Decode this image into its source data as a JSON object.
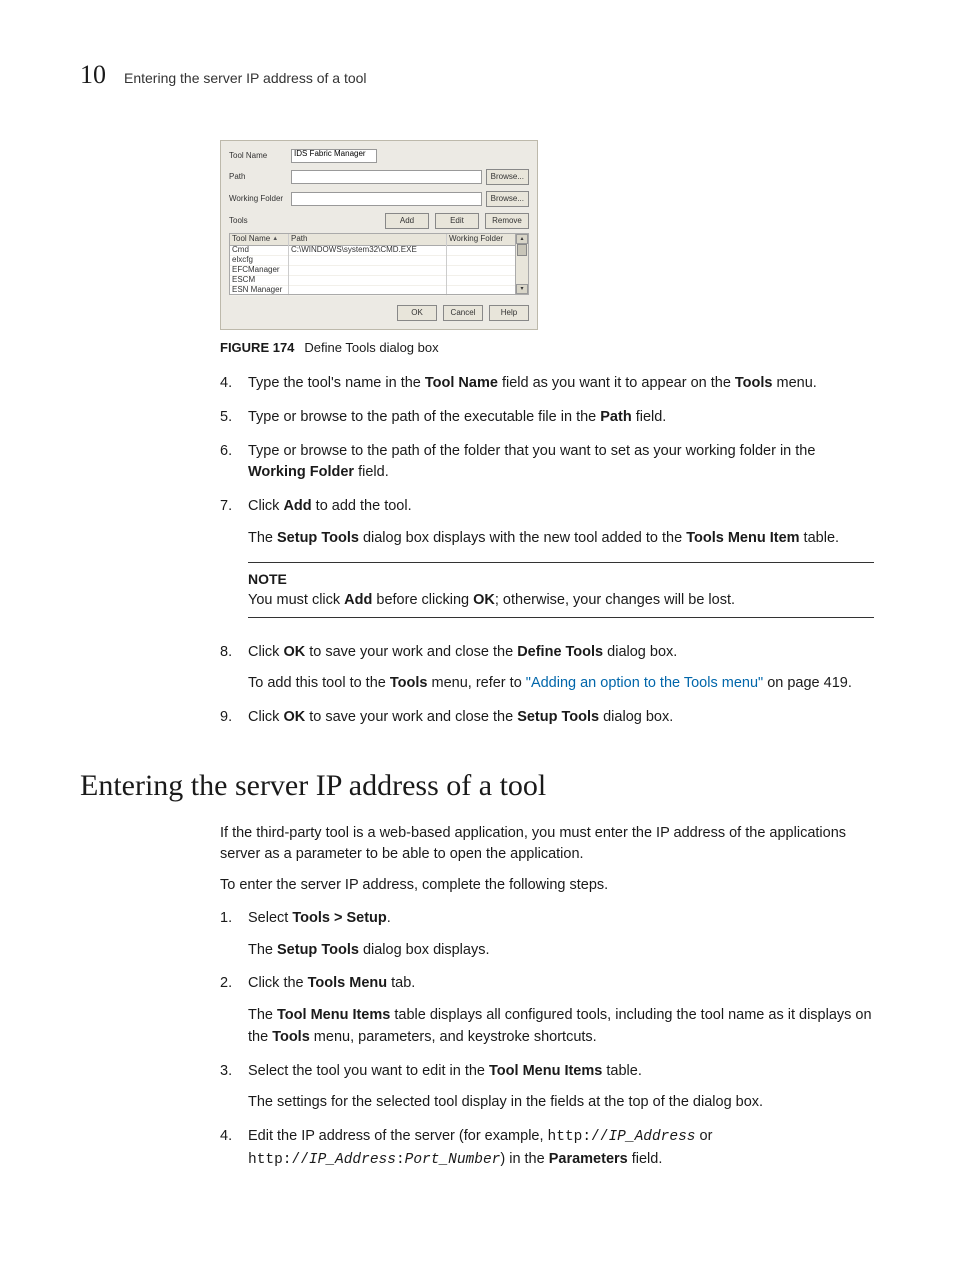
{
  "header": {
    "chapter_number": "10",
    "running_title": "Entering the server IP address of a tool"
  },
  "dialog": {
    "labels": {
      "tool_name": "Tool Name",
      "path": "Path",
      "working_folder": "Working Folder",
      "tools": "Tools"
    },
    "tool_name_value": "IDS Fabric Manager",
    "browse_label": "Browse...",
    "add_label": "Add",
    "edit_label": "Edit",
    "remove_label": "Remove",
    "ok_label": "OK",
    "cancel_label": "Cancel",
    "help_label": "Help",
    "columns": {
      "tool_name": "Tool Name",
      "path": "Path",
      "working_folder": "Working Folder"
    },
    "rows": [
      {
        "name": "Cmd",
        "path": "C:\\WINDOWS\\system32\\CMD.EXE",
        "wf": ""
      },
      {
        "name": "elxcfg",
        "path": "",
        "wf": ""
      },
      {
        "name": "EFCManager",
        "path": "",
        "wf": ""
      },
      {
        "name": "ESCM",
        "path": "",
        "wf": ""
      },
      {
        "name": "ESN Manager",
        "path": "",
        "wf": ""
      }
    ]
  },
  "figure": {
    "number": "FIGURE 174",
    "caption": "Define Tools dialog box"
  },
  "stepsA": {
    "s4": {
      "n": "4.",
      "pre": "Type the tool's name in the ",
      "b1": "Tool Name",
      "mid": " field as you want it to appear on the ",
      "b2": "Tools",
      "post": " menu."
    },
    "s5": {
      "n": "5.",
      "pre": "Type or browse to the path of the executable file in the ",
      "b1": "Path",
      "post": " field."
    },
    "s6": {
      "n": "6.",
      "pre": "Type or browse to the path of the folder that you want to set as your working folder in the ",
      "b1": "Working Folder",
      "post": " field."
    },
    "s7": {
      "n": "7.",
      "pre": "Click ",
      "b1": "Add",
      "post": " to add the tool.",
      "sub_pre": "The ",
      "sub_b1": "Setup Tools",
      "sub_mid": " dialog box displays with the new tool added to the ",
      "sub_b2": "Tools Menu Item",
      "sub_post": " table."
    },
    "note": {
      "head": "NOTE",
      "pre": "You must click ",
      "b1": "Add",
      "mid": " before clicking ",
      "b2": "OK",
      "post": "; otherwise, your changes will be lost."
    },
    "s8": {
      "n": "8.",
      "pre": "Click ",
      "b1": "OK",
      "mid": " to save your work and close the ",
      "b2": "Define Tools",
      "post": " dialog box.",
      "sub_pre": "To add this tool to the ",
      "sub_b1": "Tools",
      "sub_mid": " menu, refer to ",
      "link": "\"Adding an option to the Tools menu\"",
      "sub_post": " on page 419."
    },
    "s9": {
      "n": "9.",
      "pre": "Click ",
      "b1": "OK",
      "mid": " to save your work and close the ",
      "b2": "Setup Tools",
      "post": " dialog box."
    }
  },
  "sectionB": {
    "heading": "Entering the server IP address of a tool",
    "intro": "If the third-party tool is a web-based application, you must enter the IP address of the applications server as a parameter to be able to open the application.",
    "lead": "To enter the server IP address, complete the following steps.",
    "s1": {
      "n": "1.",
      "pre": "Select ",
      "b1": "Tools > Setup",
      "post": ".",
      "sub_pre": "The ",
      "sub_b1": "Setup Tools",
      "sub_post": " dialog box displays."
    },
    "s2": {
      "n": "2.",
      "pre": "Click the ",
      "b1": "Tools Menu",
      "post": " tab.",
      "sub_pre": "The ",
      "sub_b1": "Tool Menu Items",
      "sub_mid": " table displays all configured tools, including the tool name as it displays on the ",
      "sub_b2": "Tools",
      "sub_post": " menu, parameters, and keystroke shortcuts."
    },
    "s3": {
      "n": "3.",
      "pre": "Select the tool you want to edit in the ",
      "b1": "Tool Menu Items",
      "post": " table.",
      "sub": "The settings for the selected tool display in the fields at the top of the dialog box."
    },
    "s4": {
      "n": "4.",
      "pre": "Edit the IP address of the server (for example, ",
      "code1a": "http://",
      "code1b": "IP_Address",
      "mid1": " or ",
      "code2a": "http://",
      "code2b": "IP_Address",
      "code2c": ":",
      "code2d": "Port_Number",
      "mid2": ") in the ",
      "b1": "Parameters",
      "post": " field."
    }
  }
}
